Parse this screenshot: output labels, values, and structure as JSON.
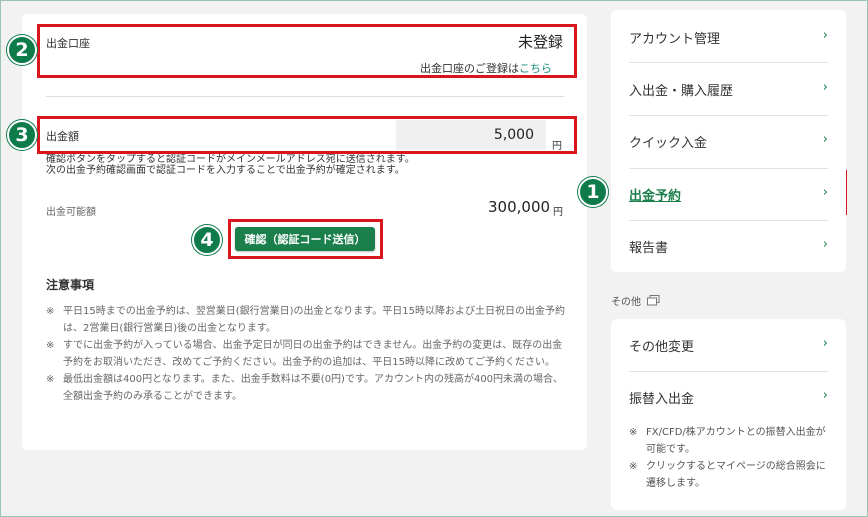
{
  "withdrawal_account": {
    "label": "出金口座",
    "status": "未登録",
    "register_prefix": "出金口座のご登録は",
    "register_link": "こちら"
  },
  "amount": {
    "label": "出金額",
    "value": "5,000",
    "unit": "円",
    "info_line1": "確認ボタンをタップすると認証コードがメインメールアドレス宛に送信されます。",
    "info_line2": "次の出金予約確認画面で認証コードを入力することで出金予約が確定されます。"
  },
  "available": {
    "label": "出金可能額",
    "value": "300,000",
    "unit": "円"
  },
  "confirm_button": "確認（認証コード送信）",
  "notes": {
    "title": "注意事項",
    "mark": "※",
    "items": [
      "平日15時までの出金予約は、翌営業日(銀行営業日)の出金となります。平日15時以降および土日祝日の出金予約は、2営業日(銀行営業日)後の出金となります。",
      "すでに出金予約が入っている場合、出金予定日が同日の出金予約はできません。出金予約の変更は、既存の出金予約をお取消いただき、改めてご予約ください。出金予約の追加は、平日15時以降に改めてご予約ください。",
      "最低出金額は400円となります。また、出金手数料は不要(0円)です。アカウント内の残高が400円未満の場合、全額出金予約のみ承ることができます。"
    ]
  },
  "badges": [
    "1",
    "2",
    "3",
    "4"
  ],
  "sidebar": {
    "items": [
      "アカウント管理",
      "入出金・購入履歴",
      "クイック入金",
      "出金予約",
      "報告書"
    ],
    "other_heading": "その他",
    "other_items": [
      "その他変更",
      "振替入出金"
    ],
    "other_notes": [
      "FX/CFD/株アカウントとの振替入出金が可能です。",
      "クリックするとマイページの総合照会に遷移します。"
    ],
    "chevron": "›"
  },
  "colors": {
    "accent": "#1a7f4b",
    "highlight": "#d9161d",
    "badge": "#0e7c4a"
  }
}
